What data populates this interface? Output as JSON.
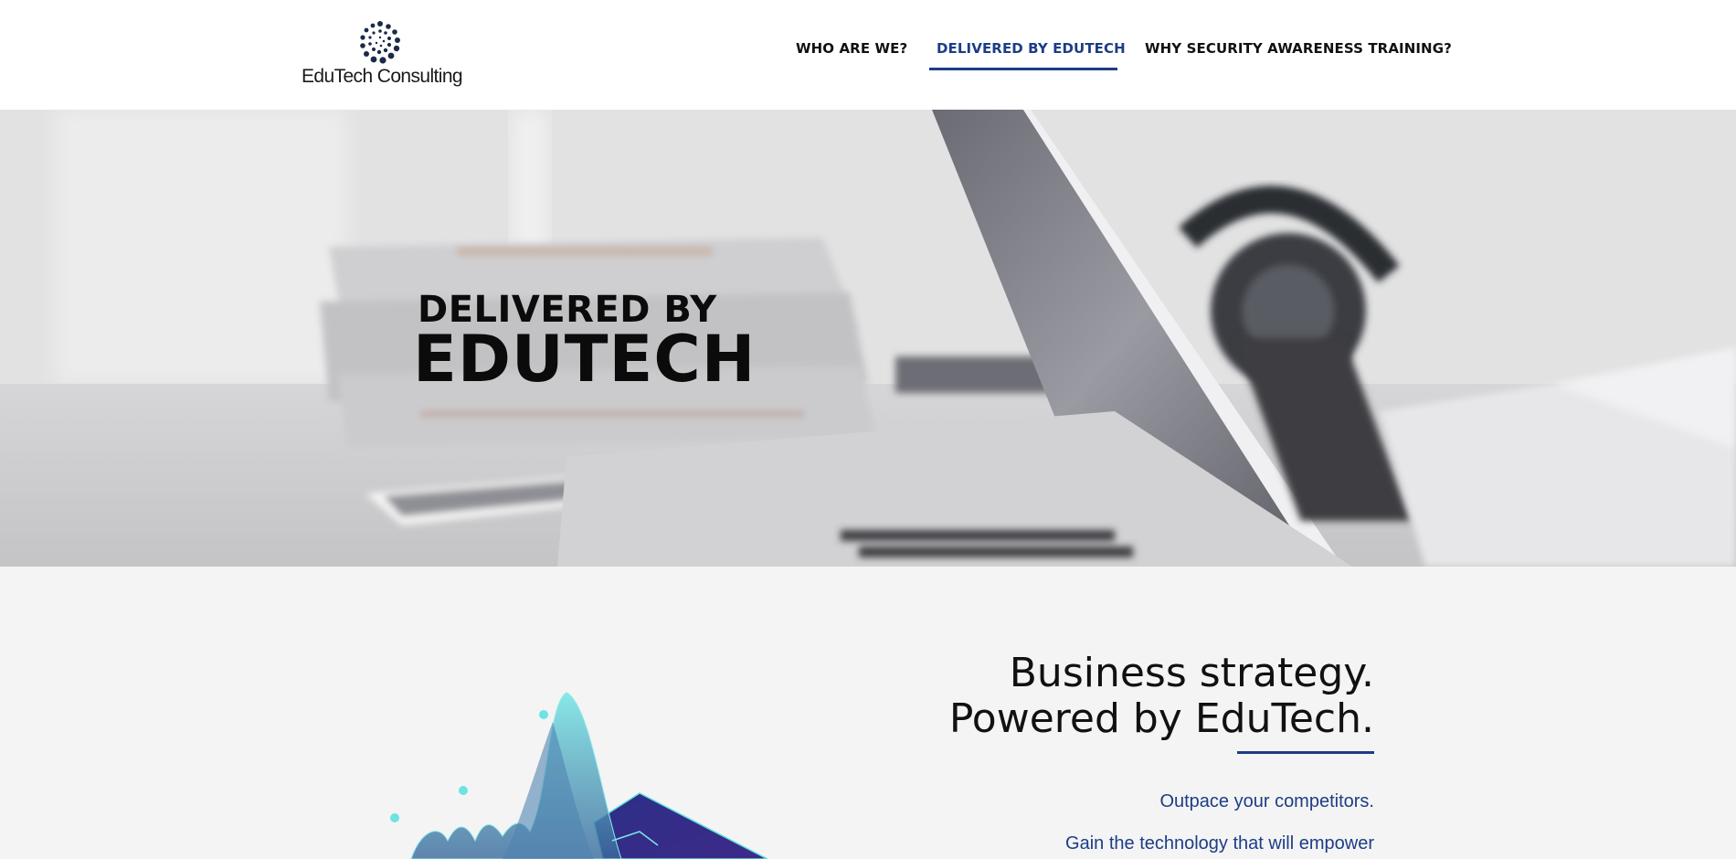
{
  "brand": {
    "name": "EduTech Consulting",
    "logo_icon": "dotted-circle-logo-icon"
  },
  "nav": {
    "items": [
      {
        "label": "WHO ARE WE?",
        "active": false
      },
      {
        "label": "DELIVERED BY EDUTECH",
        "active": true
      },
      {
        "label": "WHY SECURITY AWARENESS TRAINING?",
        "active": false
      }
    ],
    "active_color": "#1c3d86"
  },
  "hero": {
    "line1": "DELIVERED BY",
    "line2": "EDUTECH"
  },
  "section": {
    "heading_line1": "Business strategy.",
    "heading_line2": "Powered by EduTech.",
    "lead_1": "Outpace your competitors.",
    "lead_2": "Gain the technology that will empower",
    "accent_color": "#1c3d86"
  }
}
